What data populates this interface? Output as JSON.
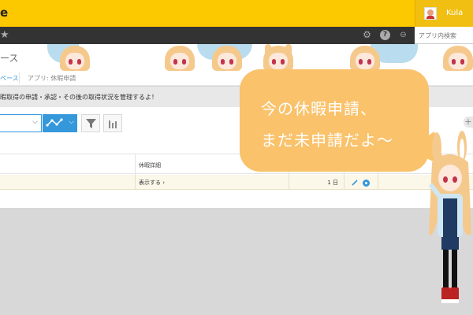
{
  "topbar": {
    "logo_text": "e",
    "username": "Kula"
  },
  "toolbar_icons": [
    "star-icon",
    "gear-icon",
    "help-icon",
    "link-icon"
  ],
  "app_search": {
    "placeholder": "アプリ内検索"
  },
  "banner": {
    "title": "ース"
  },
  "breadcrumb": {
    "home": "ペース",
    "app": "アプリ: 休暇申請"
  },
  "description": "暇取得の申請・承認・その後の取得状況を管理するよ！",
  "table": {
    "headers": {
      "detail": "休暇詳細"
    },
    "rows": [
      {
        "detail": "表示する",
        "detail_suffix": "›",
        "days": "1 日"
      }
    ]
  },
  "bubble": {
    "line1": "今の休暇申請、",
    "line2": "まだ未申請だよ～"
  },
  "colors": {
    "topbar": "#fcc800",
    "accent": "#3498db",
    "bubble": "#f9c26b"
  }
}
